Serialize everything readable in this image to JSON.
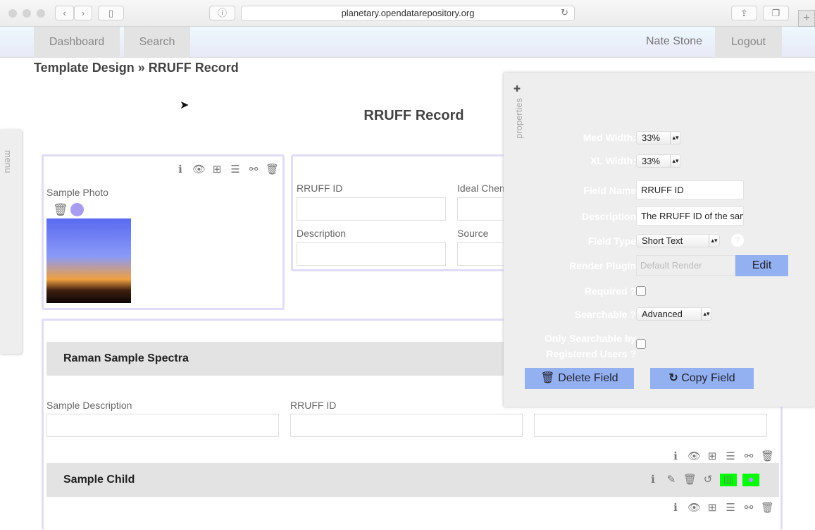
{
  "browser": {
    "url": "planetary.opendatarepository.org"
  },
  "nav": {
    "tabs": [
      "Dashboard",
      "Search"
    ],
    "user": "Nate Stone",
    "logout": "Logout"
  },
  "breadcrumb": {
    "parent": "Template Design",
    "separator": "»",
    "current": "RRUFF Record"
  },
  "page_title": "RRUFF Record",
  "menu_label": "menu",
  "photo_box": {
    "label": "Sample Photo"
  },
  "fields_box": {
    "fields": [
      "RRUFF ID",
      "Ideal Chem",
      "Description",
      "Source"
    ]
  },
  "child_box": {
    "header": "Raman Sample Spectra",
    "fields": [
      "Sample Description",
      "RRUFF ID"
    ],
    "child_header": "Sample Child"
  },
  "properties": {
    "tab_label": "properties",
    "med_width_label": "Med Width:",
    "med_width": "33%",
    "xl_width_label": "XL Width:",
    "xl_width": "33%",
    "field_name_label": "Field Name",
    "field_name": "RRUFF ID",
    "description_label": "Description",
    "description": "The RRUFF ID of the sample",
    "field_type_label": "Field Type",
    "field_type": "Short Text",
    "render_plugin_label": "Render Plugin",
    "render_plugin_placeholder": "Default Render",
    "edit": "Edit",
    "required_label": "Required ?",
    "searchable_label": "Searchable ?",
    "searchable": "Advanced",
    "registered_label_1": "Only Searchable by",
    "registered_label_2": "Registered Users ?",
    "delete": "Delete Field",
    "copy": "Copy Field"
  },
  "colors": {
    "accent": "#93b0f1",
    "box_border": "#e0dcf8",
    "highlight": "#00ff00"
  }
}
